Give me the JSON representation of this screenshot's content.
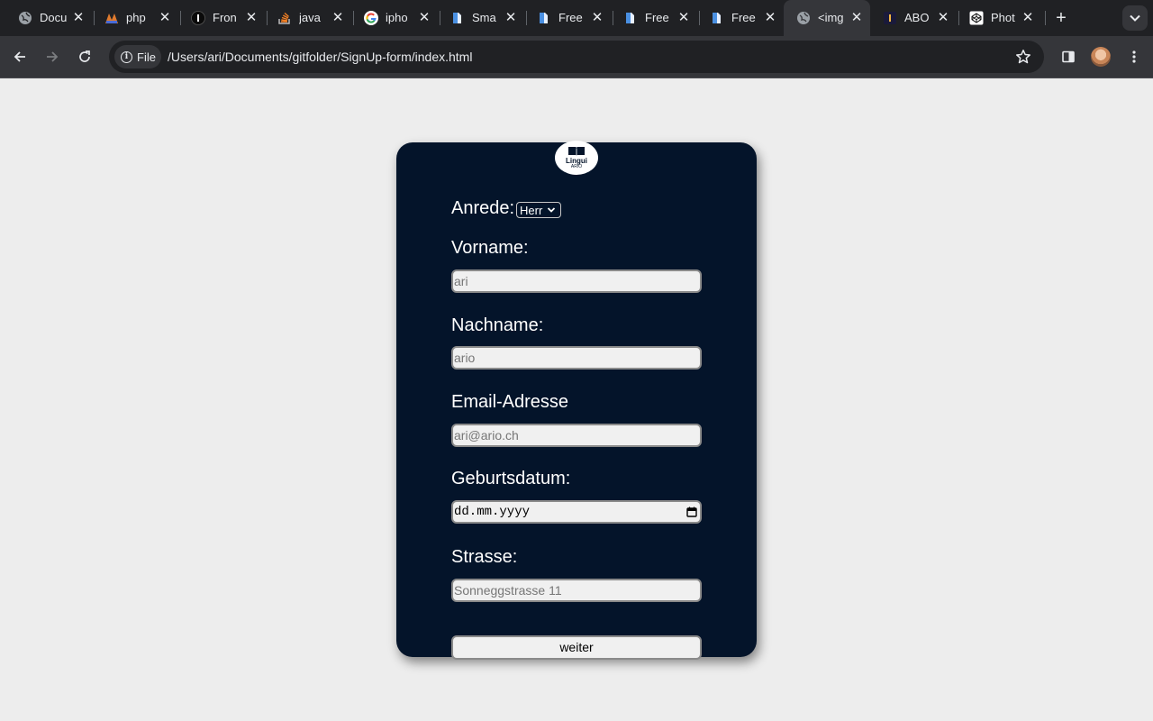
{
  "browser": {
    "tabs": [
      {
        "title": "Docu",
        "icon": "globe-icon"
      },
      {
        "title": "php",
        "icon": "phpstan-icon"
      },
      {
        "title": "Fron",
        "icon": "info-icon"
      },
      {
        "title": "java",
        "icon": "stackoverflow-icon"
      },
      {
        "title": "ipho",
        "icon": "google-icon"
      },
      {
        "title": "Sma",
        "icon": "doc-icon"
      },
      {
        "title": "Free",
        "icon": "doc-icon"
      },
      {
        "title": "Free",
        "icon": "doc-icon"
      },
      {
        "title": "Free",
        "icon": "doc-icon"
      },
      {
        "title": "<img",
        "icon": "globe-icon"
      },
      {
        "title": "ABO",
        "icon": "ticket-icon"
      },
      {
        "title": "Phot",
        "icon": "codepen-icon"
      }
    ],
    "active_tab_index": 9,
    "newtab_label": "+",
    "address": {
      "chip_label": "File",
      "url": "/Users/ari/Documents/gitfolder/SignUp-form/index.html"
    }
  },
  "form": {
    "logo": {
      "title": "Lingui",
      "subtitle": "ARIO"
    },
    "anrede": {
      "label": "Anrede:",
      "selected": "Herr"
    },
    "vorname": {
      "label": "Vorname:",
      "placeholder": "ari"
    },
    "nachname": {
      "label": "Nachname:",
      "placeholder": "ario"
    },
    "email": {
      "label": "Email-Adresse",
      "placeholder": "ari@ario.ch"
    },
    "geburtsdatum": {
      "label": "Geburtsdatum:",
      "placeholder": "dd.mm.yyyy"
    },
    "strasse": {
      "label": "Strasse:",
      "placeholder": "Sonneggstrasse 11"
    },
    "submit_label": "weiter"
  },
  "colors": {
    "page_background": "#ededed",
    "card_background": "#04142a",
    "chrome_dark": "#202124",
    "chrome_toolbar": "#35363a"
  }
}
